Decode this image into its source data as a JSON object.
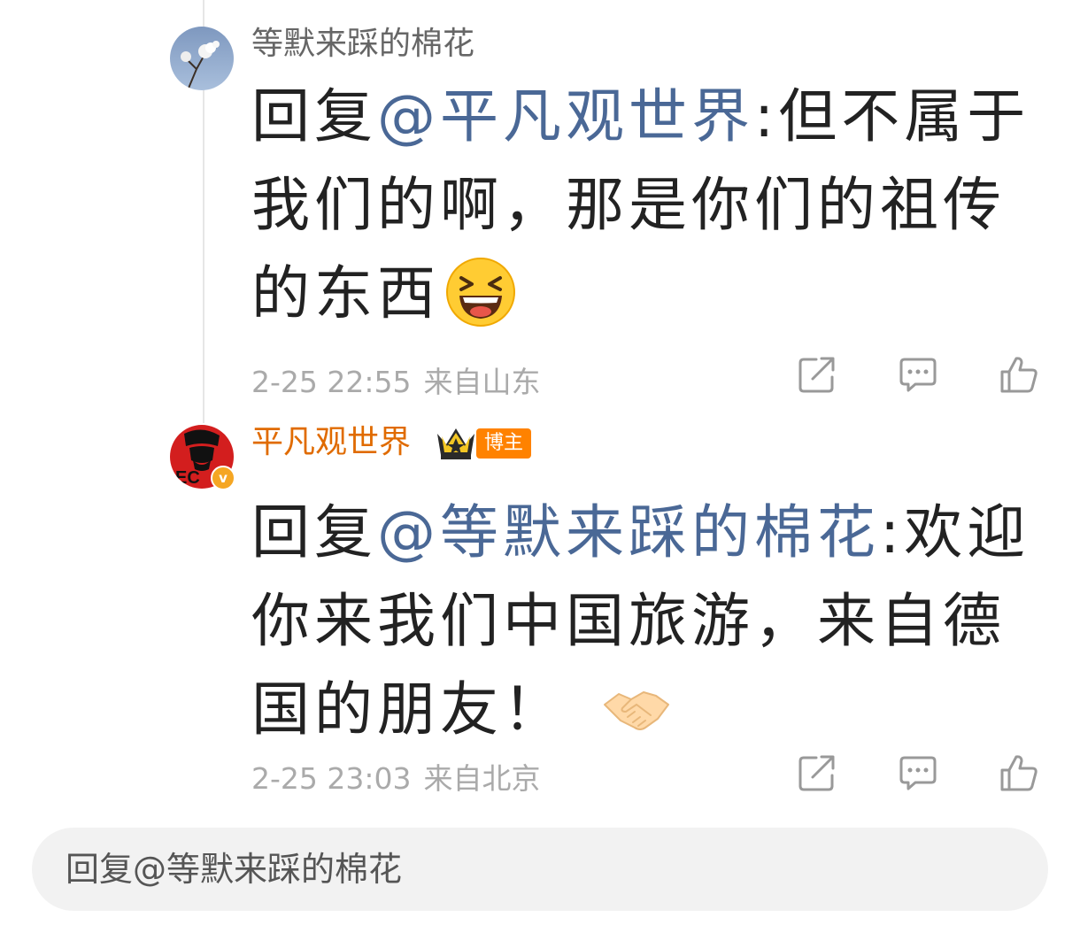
{
  "comments": [
    {
      "author": "等默来踩的棉花",
      "reply_prefix": "回复",
      "mention": "@平凡观世界",
      "text": ":但不属于我们的啊，那是你们的祖传的东西",
      "emoji": "laughing-face-emoji",
      "time": "2-25 22:55",
      "location": "来自山东"
    },
    {
      "author": "平凡观世界",
      "badge": "博主",
      "reply_prefix": "回复",
      "mention": "@等默来踩的棉花",
      "text": ":欢迎你来我们中国旅游，来自德国的朋友！",
      "emoji": "handshake-emoji",
      "time": "2-25 23:03",
      "location": "来自北京"
    }
  ],
  "reply_bar": {
    "placeholder": "回复@等默来踩的棉花"
  },
  "icons": {
    "share": "share-icon",
    "reply": "comment-icon",
    "like": "thumbs-up-icon"
  },
  "colors": {
    "author_blogger": "#e06b00",
    "mention": "#4a6896",
    "badge_bg": "#ff8200",
    "verified": "#f5a623"
  }
}
